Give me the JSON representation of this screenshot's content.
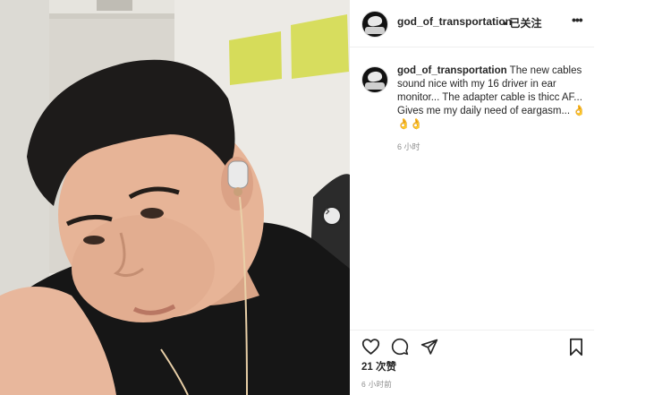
{
  "post": {
    "username": "god_of_transportation",
    "follow_label": "已关注",
    "separator": "•",
    "more_label": "•••",
    "caption_user": "god_of_transportation",
    "caption_text": "The new cables sound nice with my 16 driver in ear monitor... The adapter cable is thicc AF... Gives me my daily need of eargasm... 👌👌👌",
    "caption_time": "6 小时",
    "likes": "21 次赞",
    "post_time": "6 小时前"
  },
  "icons": {
    "like": "heart-icon",
    "comment": "comment-icon",
    "share": "paper-plane-icon",
    "save": "bookmark-icon",
    "carousel": "chevron-right-icon",
    "more": "more-options-icon"
  },
  "colors": {
    "text": "#262626",
    "muted": "#8e8e8e",
    "divider": "#efefef",
    "background": "#ffffff"
  }
}
